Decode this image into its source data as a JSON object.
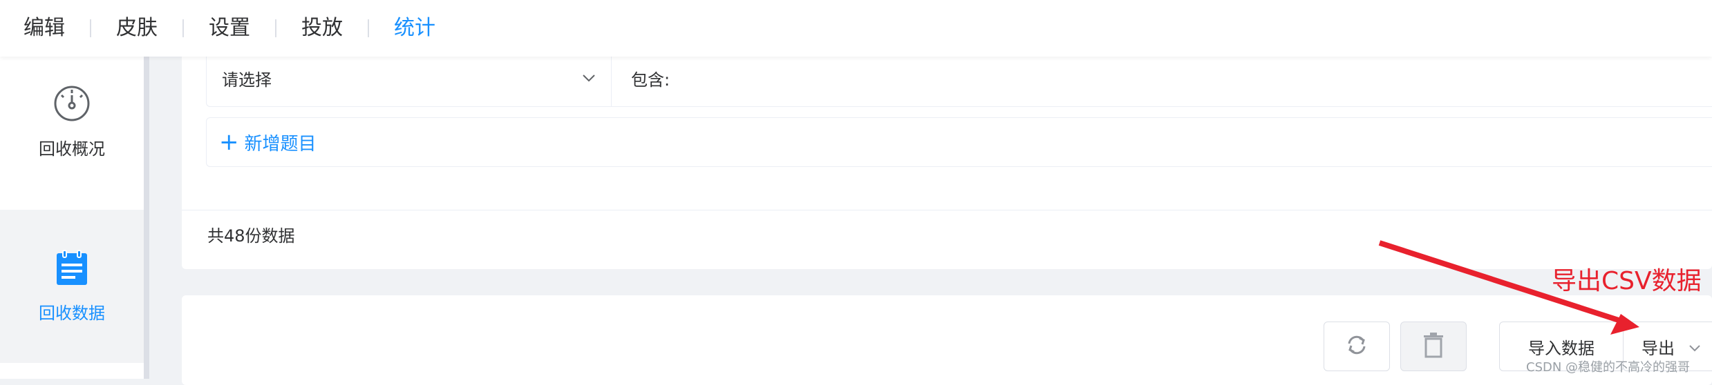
{
  "topnav": {
    "items": [
      "编辑",
      "皮肤",
      "设置",
      "投放",
      "统计"
    ],
    "active_index": 4
  },
  "sidebar": {
    "items": [
      {
        "label": "回收概况",
        "icon": "gauge-icon"
      },
      {
        "label": "回收数据",
        "icon": "clipboard-icon",
        "active": true
      }
    ]
  },
  "filter": {
    "select_placeholder": "请选择",
    "contains_label": "包含:"
  },
  "add_question_label": "新增题目",
  "record_count_text": "共48份数据",
  "toolbar": {
    "refresh_icon": "refresh-icon",
    "delete_icon": "trash-icon",
    "import_label": "导入数据",
    "export_label": "导出"
  },
  "annotation": {
    "text": "导出CSV数据",
    "color": "#e8212d"
  },
  "watermark": "CSDN @稳健的不高冷的强哥",
  "colors": {
    "accent": "#1890ff",
    "text": "#303133",
    "border": "#dcdfe6"
  }
}
